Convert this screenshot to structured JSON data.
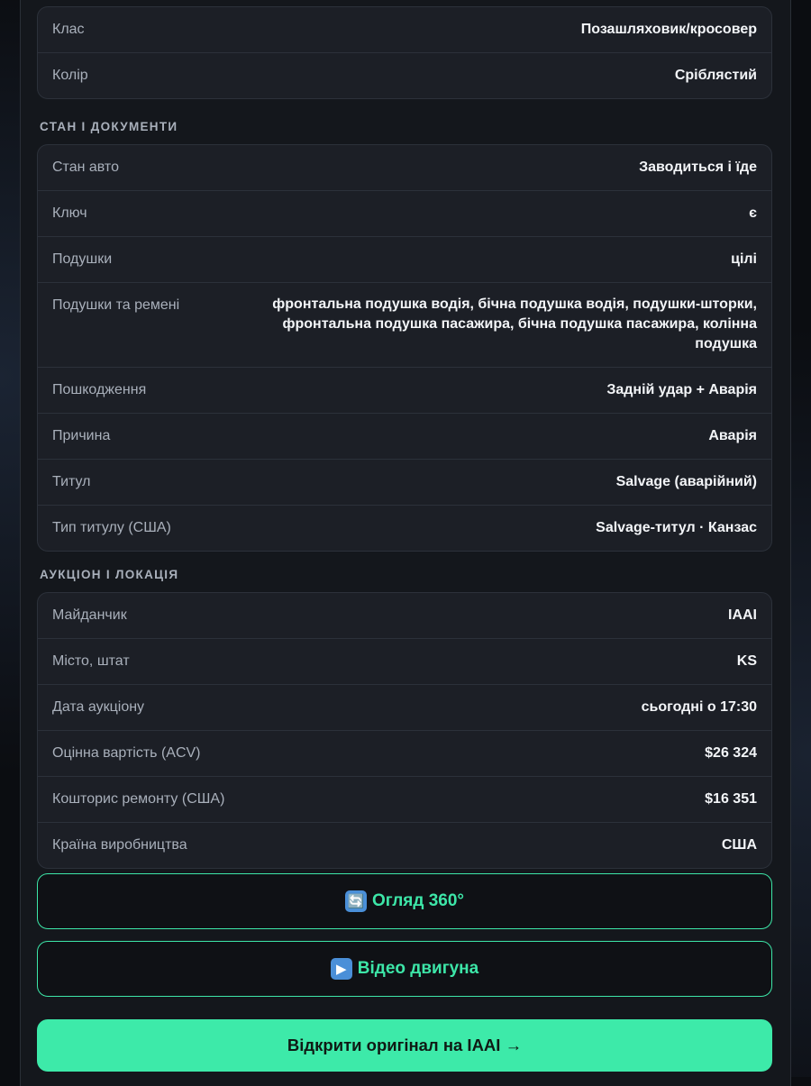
{
  "vehicle": {
    "rows": [
      {
        "label": "Клас",
        "value": "Позашляховик/кросовер"
      },
      {
        "label": "Колір",
        "value": "Сріблястий"
      }
    ]
  },
  "condition": {
    "title": "СТАН І ДОКУМЕНТИ",
    "rows": [
      {
        "label": "Стан авто",
        "value": "Заводиться і їде"
      },
      {
        "label": "Ключ",
        "value": "є"
      },
      {
        "label": "Подушки",
        "value": "цілі"
      },
      {
        "label": "Подушки та ремені",
        "value": "фронтальна подушка водія, бічна подушка водія, подушки-шторки, фронтальна подушка пасажира, бічна подушка пасажира, колінна подушка"
      },
      {
        "label": "Пошкодження",
        "value": "Задній удар + Аварія"
      },
      {
        "label": "Причина",
        "value": "Аварія"
      },
      {
        "label": "Титул",
        "value": "Salvage (аварійний)"
      },
      {
        "label": "Тип титулу (США)",
        "value": "Salvage-титул · Канзас"
      }
    ]
  },
  "auction": {
    "title": "АУКЦІОН І ЛОКАЦІЯ",
    "rows": [
      {
        "label": "Майданчик",
        "value": "IAAI"
      },
      {
        "label": "Місто, штат",
        "value": "KS"
      },
      {
        "label": "Дата аукціону",
        "value": "сьогодні о 17:30"
      },
      {
        "label": "Оцінна вартість (ACV)",
        "value": "$26 324"
      },
      {
        "label": "Кошторис ремонту (США)",
        "value": "$16 351"
      },
      {
        "label": "Країна виробництва",
        "value": "США"
      }
    ]
  },
  "actions": {
    "view360": {
      "icon": "rotate-arrows-icon",
      "glyph": "🔄",
      "label": "Огляд 360°"
    },
    "engine_video": {
      "icon": "play-icon",
      "glyph": "▶",
      "label": "Відео двигуна"
    },
    "open_original": {
      "label": "Відкрити оригінал на IAAI →"
    }
  },
  "colors": {
    "accent": "#3deaa9",
    "card_bg": "#1c1f26",
    "panel_bg": "#14171c"
  }
}
